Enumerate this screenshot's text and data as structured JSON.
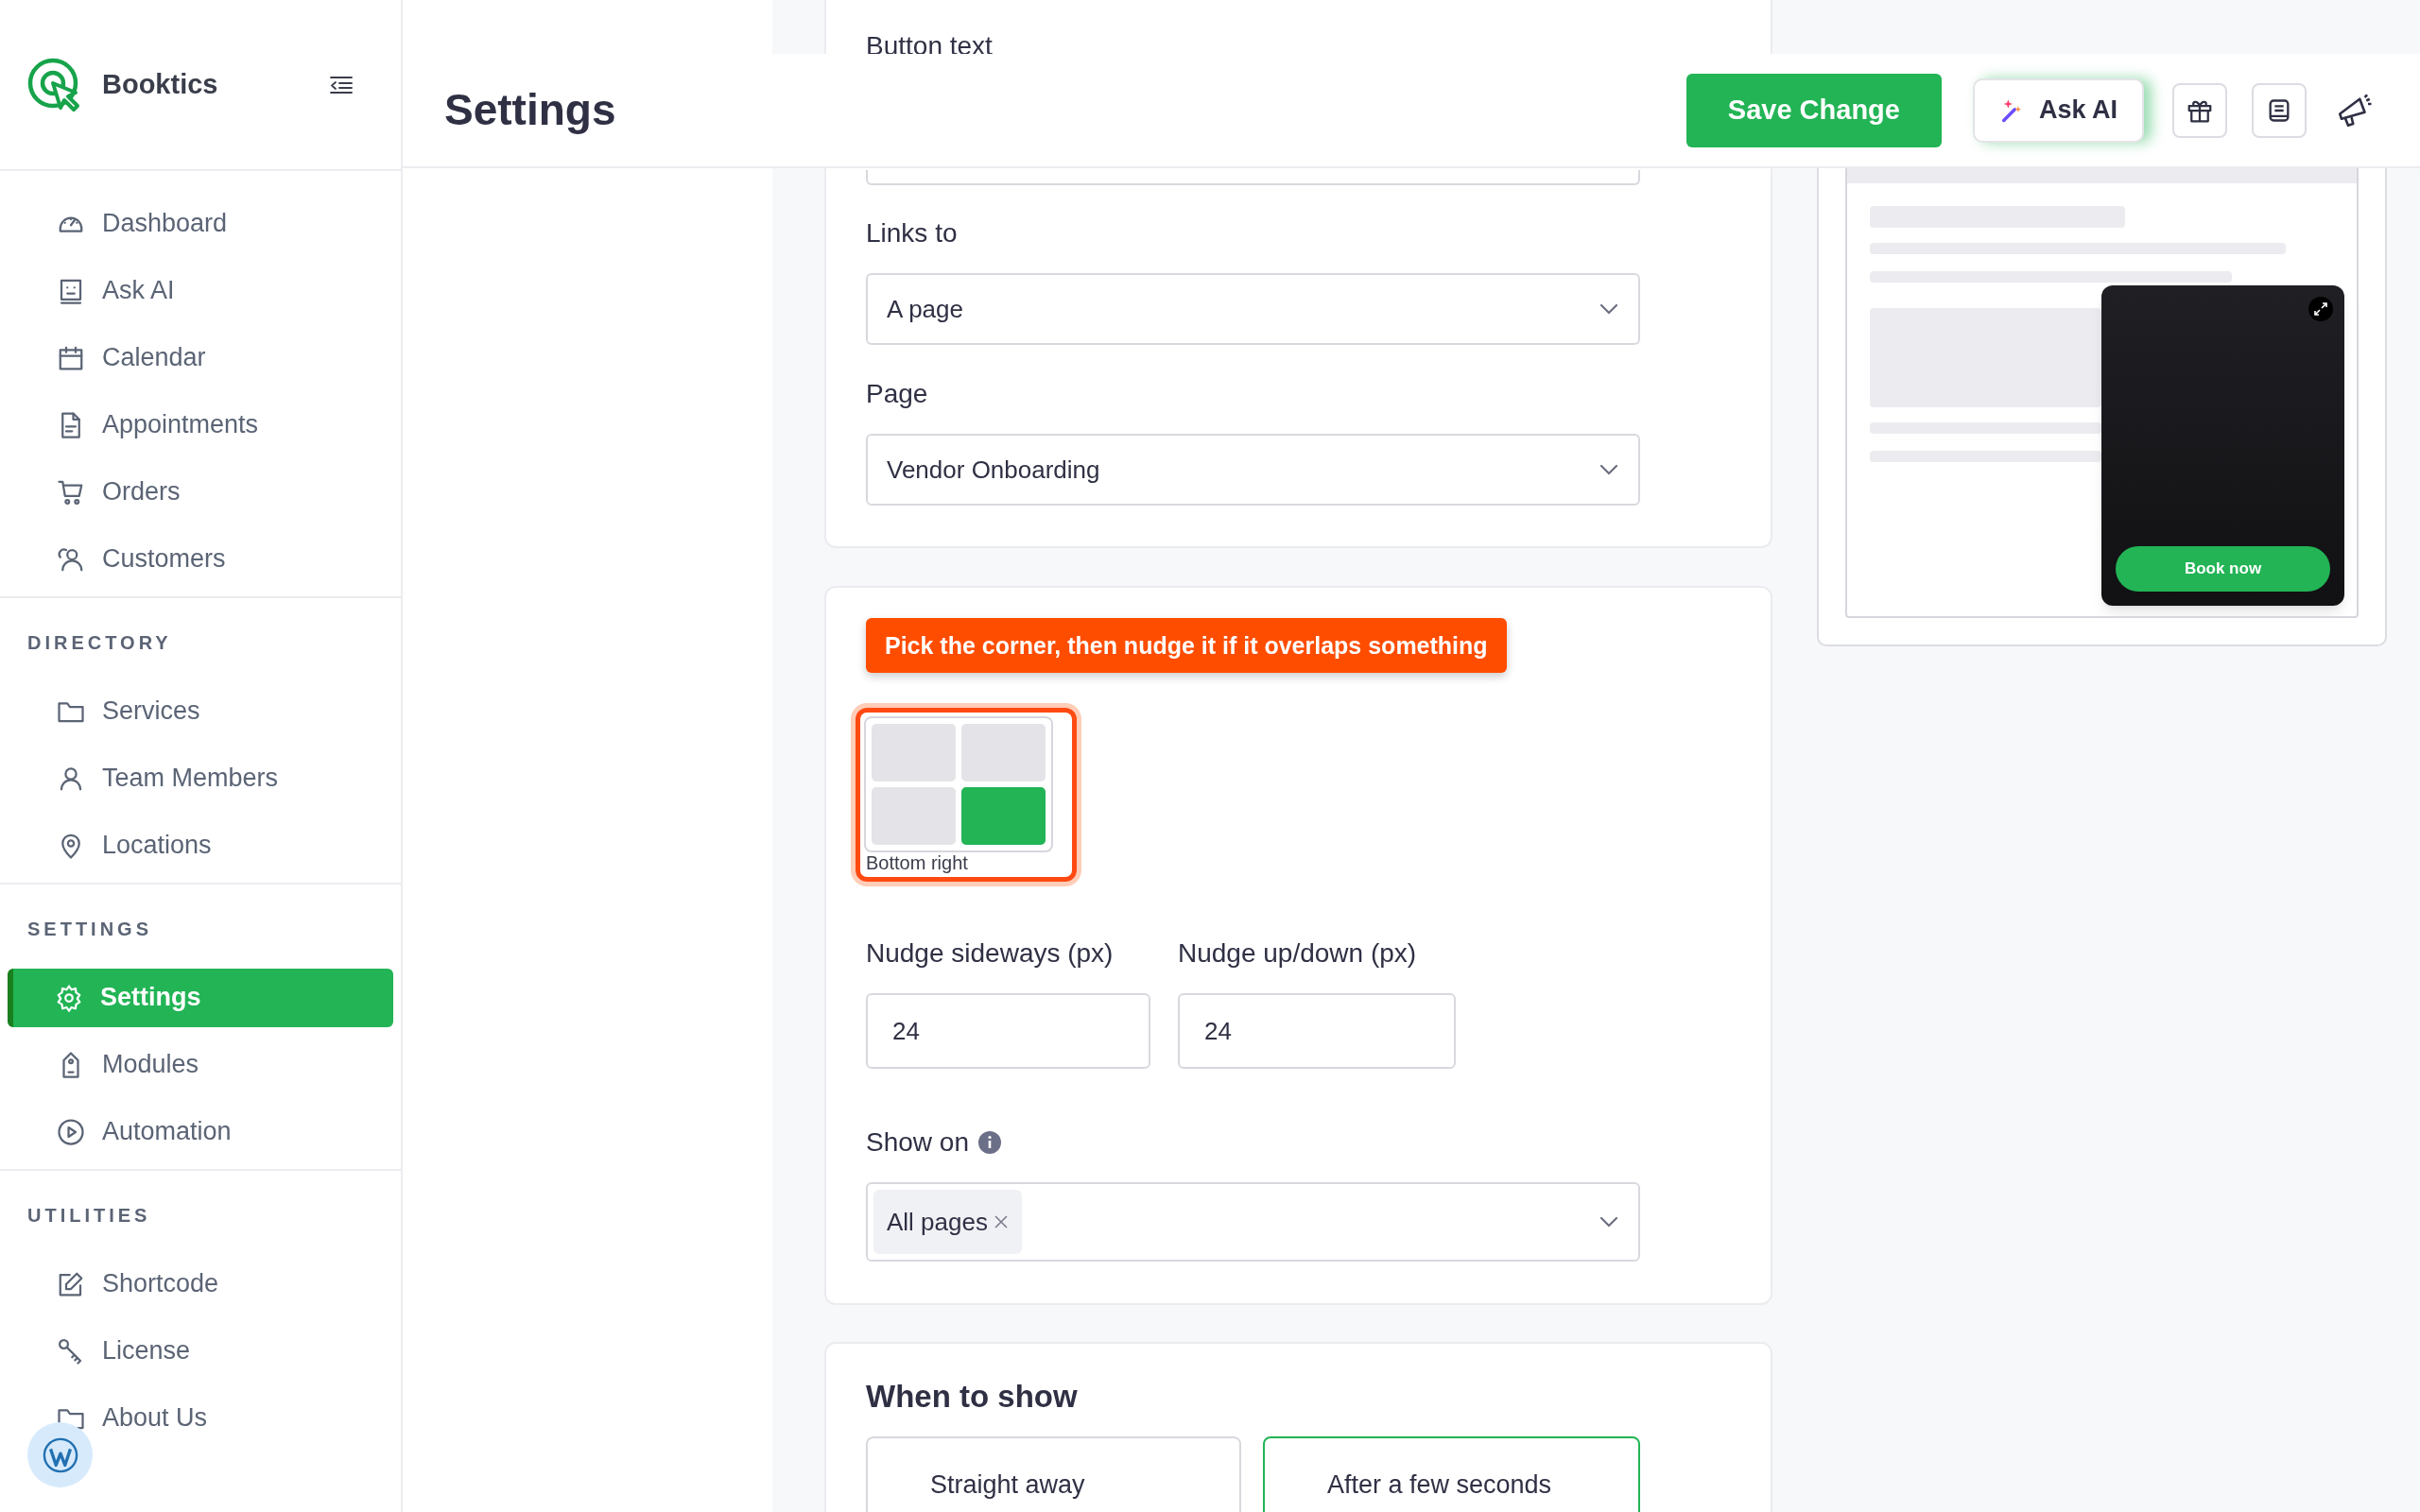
{
  "app": {
    "name": "Booktics"
  },
  "sidebar": {
    "sections": [
      {
        "items": [
          {
            "label": "Dashboard",
            "selected": false
          },
          {
            "label": "Ask AI",
            "selected": false
          },
          {
            "label": "Calendar",
            "selected": false
          },
          {
            "label": "Appointments",
            "selected": false
          },
          {
            "label": "Orders",
            "selected": false
          },
          {
            "label": "Customers",
            "selected": false
          }
        ]
      },
      {
        "heading": "DIRECTORY",
        "items": [
          {
            "label": "Services",
            "selected": false
          },
          {
            "label": "Team Members",
            "selected": false
          },
          {
            "label": "Locations",
            "selected": false
          }
        ]
      },
      {
        "heading": "SETTINGS",
        "items": [
          {
            "label": "Settings",
            "selected": true
          },
          {
            "label": "Modules",
            "selected": false
          },
          {
            "label": "Automation",
            "selected": false
          }
        ]
      },
      {
        "heading": "UTILITIES",
        "items": [
          {
            "label": "Shortcode",
            "selected": false
          },
          {
            "label": "License",
            "selected": false
          },
          {
            "label": "About Us",
            "selected": false
          }
        ]
      }
    ]
  },
  "header": {
    "title": "Settings",
    "save_button": "Save Change",
    "ask_ai_button": "Ask AI"
  },
  "button_card": {
    "button_text_label": "Button text",
    "links_to": {
      "label": "Links to",
      "value": "A page"
    },
    "page": {
      "label": "Page",
      "value": "Vendor Onboarding"
    }
  },
  "position_card": {
    "hint": "Pick the corner, then nudge it if it overlaps something",
    "corners": [
      {
        "selected": false
      },
      {
        "selected": false
      },
      {
        "selected": false
      },
      {
        "selected": true
      }
    ],
    "corner_caption": "Bottom right",
    "nudge_fields": [
      {
        "label": "Nudge sideways (px)",
        "value": "24"
      },
      {
        "label": "Nudge up/down (px)",
        "value": "24"
      }
    ],
    "show_on": {
      "label": "Show on",
      "tags": [
        "All pages"
      ]
    }
  },
  "timing_card": {
    "title": "When to show",
    "options": [
      {
        "label": "Straight away",
        "selected": false
      },
      {
        "label": "After a few seconds",
        "selected": true
      }
    ]
  },
  "preview": {
    "button": "Book now"
  }
}
